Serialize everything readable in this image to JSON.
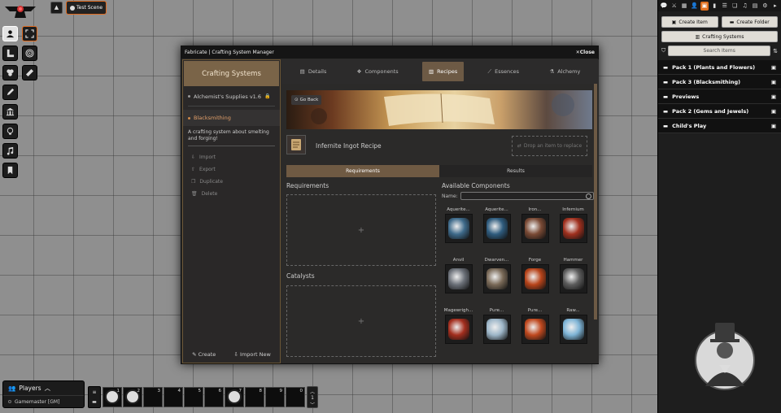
{
  "scene_nav": {
    "toggle": "▲",
    "scene": "Test Scene"
  },
  "modal": {
    "title": "Fabricate | Crafting System Manager",
    "close": "Close",
    "left": {
      "title": "Crafting Systems",
      "systems": [
        {
          "name": "Alchemist's Supplies v1.6",
          "locked": true
        },
        {
          "name": "Blacksmithing",
          "selected": true
        }
      ],
      "description": "A crafting system about smelting and forging!",
      "actions": [
        "Import",
        "Export",
        "Duplicate",
        "Delete"
      ],
      "create": "Create",
      "import_new": "Import New"
    },
    "tabs": [
      {
        "label": "Details",
        "icon": "document-icon"
      },
      {
        "label": "Components",
        "icon": "cubes-icon"
      },
      {
        "label": "Recipes",
        "icon": "book-icon",
        "active": true
      },
      {
        "label": "Essences",
        "icon": "wand-icon"
      },
      {
        "label": "Alchemy",
        "icon": "flask-icon"
      }
    ],
    "recipe": {
      "go_back": "Go Back",
      "name": "Infernite Ingot Recipe",
      "drop_hint": "Drop an item to replace",
      "subtabs": [
        {
          "label": "Requirements",
          "active": true
        },
        {
          "label": "Results"
        }
      ],
      "requirements_title": "Requirements",
      "catalysts_title": "Catalysts",
      "plus": "+"
    },
    "available": {
      "title": "Available Components",
      "name_label": "Name:",
      "name_value": "",
      "components": [
        {
          "label": "Aquerite...",
          "color": "#3e6a8a"
        },
        {
          "label": "Aquerite...",
          "color": "#2f5c7e"
        },
        {
          "label": "Iron...",
          "color": "#7a4a35"
        },
        {
          "label": "Infernium",
          "color": "#a0301e"
        },
        {
          "label": "Anvil",
          "color": "#6b7078"
        },
        {
          "label": "Dwarven...",
          "color": "#7a6a58"
        },
        {
          "label": "Forge",
          "color": "#b8441a"
        },
        {
          "label": "Hammer",
          "color": "#5c5c5c"
        },
        {
          "label": "Magewrigh...",
          "color": "#a32e1e"
        },
        {
          "label": "Pure...",
          "color": "#9db6c8"
        },
        {
          "label": "Pure...",
          "color": "#c0491f"
        },
        {
          "label": "Raw...",
          "color": "#7eb4d6"
        }
      ]
    }
  },
  "sidebar": {
    "create_item": "Create Item",
    "create_folder": "Create Folder",
    "crafting_systems": "Crafting Systems",
    "search_placeholder": "Search Items",
    "folders": [
      "Pack 1 (Plants and Flowers)",
      "Pack 3 (Blacksmithing)",
      "Previews",
      "Pack 2 (Gems and Jewels)",
      "Child's Play"
    ]
  },
  "players": {
    "title": "Players",
    "gm": "Gamemaster [GM]"
  },
  "hotbar": {
    "slots": [
      "1",
      "2",
      "3",
      "4",
      "5",
      "6",
      "7",
      "8",
      "9",
      "0"
    ],
    "page": "1"
  },
  "colors": {
    "accent": "#e06b1f",
    "tab_active": "#6d5a45",
    "panel": "#2b2a29"
  }
}
